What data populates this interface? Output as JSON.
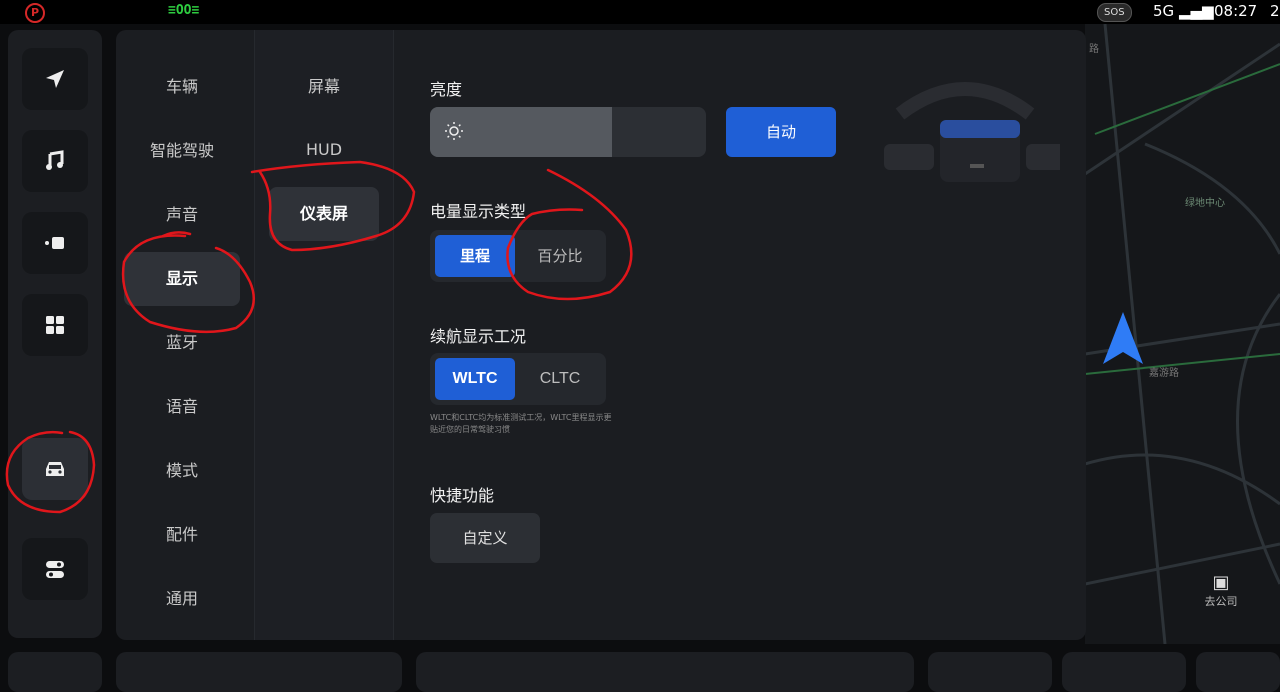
{
  "status": {
    "park_icon": "P",
    "lights_icon": "≡OO≡",
    "sos": "SOS",
    "network": "5G",
    "time": "08:27",
    "extra": "2"
  },
  "rail": {
    "icons": [
      "navigation-icon",
      "music-icon",
      "media-icon",
      "apps-icon",
      "car-icon",
      "toggle-icon"
    ]
  },
  "menu": {
    "items": [
      "车辆",
      "智能驾驶",
      "声音",
      "显示",
      "蓝牙",
      "语音",
      "模式",
      "配件",
      "通用"
    ],
    "selected": "显示"
  },
  "submenu": {
    "items": [
      "屏幕",
      "HUD",
      "仪表屏"
    ],
    "selected": "仪表屏"
  },
  "brightness": {
    "title": "亮度",
    "level": 0.66,
    "auto_label": "自动"
  },
  "battery_display": {
    "title": "电量显示类型",
    "options": [
      "里程",
      "百分比"
    ],
    "selected": "里程"
  },
  "range_display": {
    "title": "续航显示工况",
    "options": [
      "WLTC",
      "CLTC"
    ],
    "selected": "WLTC",
    "note_line1": "WLTC和CLTC均为标准测试工况，WLTC里程显示更",
    "note_line2": "贴近您的日常驾驶习惯"
  },
  "shortcut": {
    "title": "快捷功能",
    "button": "自定义"
  },
  "map": {
    "label_road": "路",
    "label_poi": "绿地中心",
    "label_street": "嘉游路",
    "go_company": "去公司"
  },
  "colors": {
    "accent": "#1f5fd6",
    "annotation": "#e0161b"
  }
}
